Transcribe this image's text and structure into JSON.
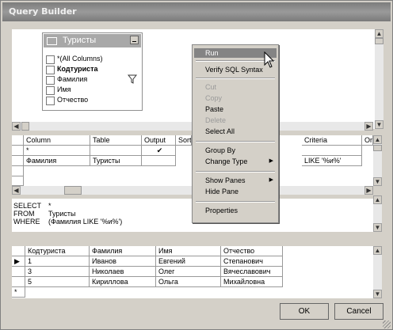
{
  "window": {
    "title": "Query Builder"
  },
  "diagram": {
    "table_name": "Туристы",
    "columns": [
      "*(All Columns)",
      "Кодтуриста",
      "Фамилия",
      "Имя",
      "Отчество"
    ]
  },
  "grid": {
    "headers": [
      "Column",
      "Table",
      "Output",
      "Sort",
      "Criteria",
      "Or"
    ],
    "rows": [
      {
        "column": "*",
        "table": "",
        "output": "✔",
        "criteria": ""
      },
      {
        "column": "Фамилия",
        "table": "Туристы",
        "output": "",
        "criteria": "LIKE '%и%'"
      }
    ]
  },
  "sql": {
    "lines": [
      {
        "kw": "SELECT",
        "val": "*"
      },
      {
        "kw": "FROM",
        "val": "Туристы"
      },
      {
        "kw": "WHERE",
        "val": "(Фамилия LIKE '%и%')"
      }
    ]
  },
  "results": {
    "headers": [
      "Кодтуриста",
      "Фамилия",
      "Имя",
      "Отчество"
    ],
    "rows": [
      [
        "1",
        "Иванов",
        "Евгений",
        "Степанович"
      ],
      [
        "3",
        "Николаев",
        "Олег",
        "Вячеславович"
      ],
      [
        "5",
        "Кириллова",
        "Ольга",
        "Михайловна"
      ]
    ],
    "new_row_marker": "*"
  },
  "context_menu": {
    "items": [
      {
        "label": "Run",
        "state": "highlighted"
      },
      {
        "label": "Verify SQL Syntax",
        "state": "enabled"
      },
      {
        "label": "Cut",
        "state": "disabled"
      },
      {
        "label": "Copy",
        "state": "disabled"
      },
      {
        "label": "Paste",
        "state": "enabled"
      },
      {
        "label": "Delete",
        "state": "disabled"
      },
      {
        "label": "Select All",
        "state": "enabled"
      },
      {
        "label": "Group By",
        "state": "enabled"
      },
      {
        "label": "Change Type",
        "state": "enabled",
        "submenu": true
      },
      {
        "label": "Show Panes",
        "state": "enabled",
        "submenu": true
      },
      {
        "label": "Hide Pane",
        "state": "enabled"
      },
      {
        "label": "Properties",
        "state": "enabled"
      }
    ]
  },
  "buttons": {
    "ok": "OK",
    "cancel": "Cancel"
  },
  "colors": {
    "titlebar": "#8a8a8a",
    "menu_highlight": "#848484",
    "dialog_bg": "#d4d0c8"
  }
}
